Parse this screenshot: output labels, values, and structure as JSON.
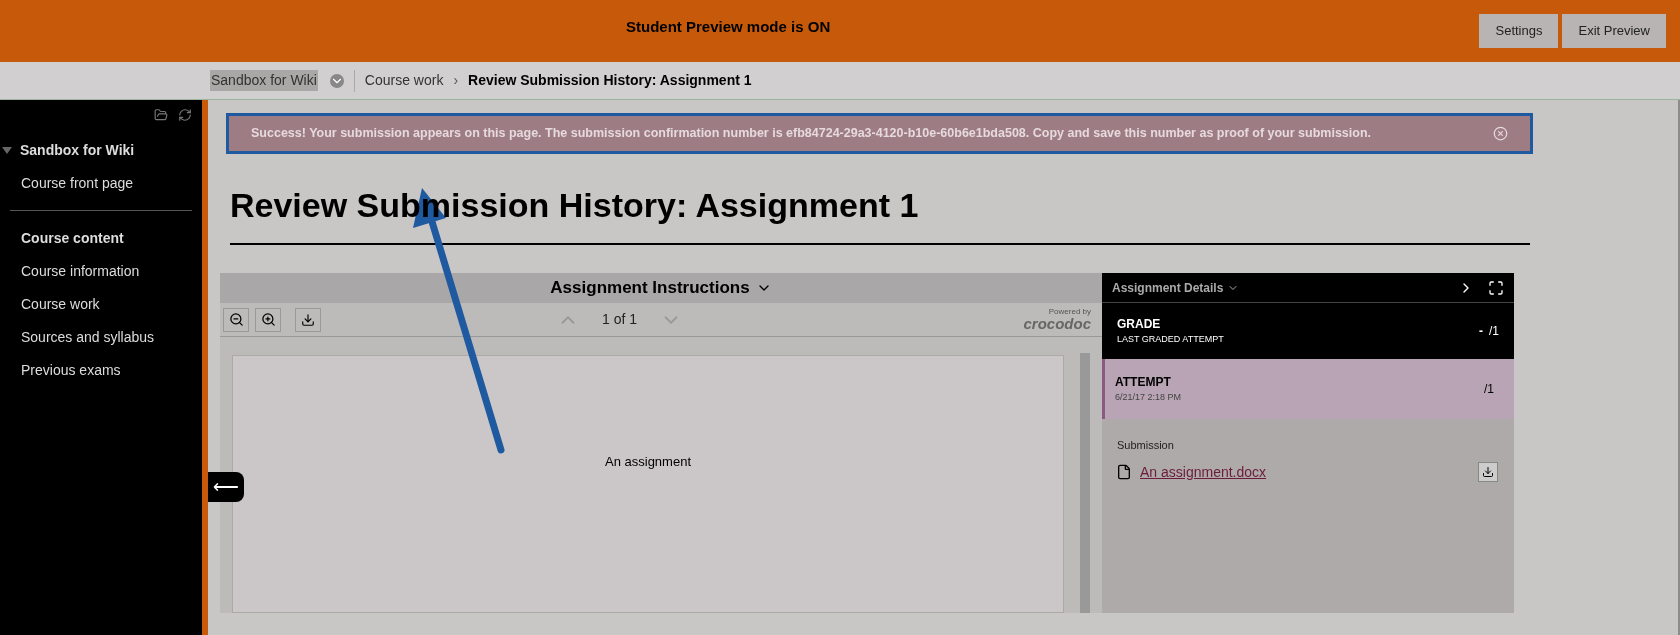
{
  "preview_bar": {
    "message": "Student Preview mode is ON",
    "buttons": [
      "Settings",
      "Exit Preview"
    ]
  },
  "breadcrumb": {
    "items": [
      "Sandbox for Wiki",
      "Course work",
      "Review Submission History: Assignment 1"
    ],
    "separator": "›"
  },
  "sidebar": {
    "course": {
      "label": "Sandbox for Wiki",
      "expanded": true
    },
    "top_items": [
      "Course front page"
    ],
    "section": "Course content",
    "items": [
      "Course information",
      "Course work",
      "Sources and syllabus",
      "Previous exams"
    ]
  },
  "alert": {
    "text": "Success! Your submission appears on this page. The submission confirmation number is efb84724-29a3-4120-b10e-60b6e1bda508. Copy and save this number as proof of your submission."
  },
  "page_title": "Review Submission History: Assignment 1",
  "viewer": {
    "title": "Assignment Instructions",
    "page": "1 of 1",
    "powered_by": "Powered by",
    "brand": "crocodoc",
    "document_text": "An assignment"
  },
  "details": {
    "title": "Assignment Details",
    "grade": {
      "label": "GRADE",
      "sub": "LAST GRADED ATTEMPT",
      "score": "-",
      "total": "/1"
    },
    "attempt": {
      "label": "ATTEMPT",
      "date": "6/21/17 2:18 PM",
      "total": "/1",
      "selected": true
    },
    "submission_label": "Submission",
    "file": "An assignment.docx"
  },
  "back_button": "⟵"
}
